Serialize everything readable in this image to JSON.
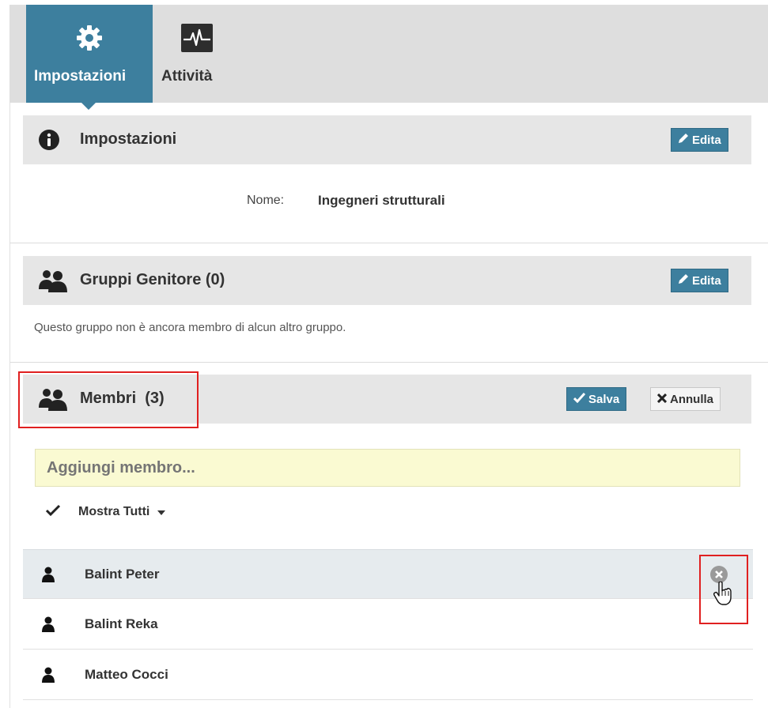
{
  "tabs": [
    {
      "label": "Impostazioni",
      "icon": "gear-icon",
      "active": true
    },
    {
      "label": "Attività",
      "icon": "activity-icon",
      "active": false
    }
  ],
  "settings": {
    "title": "Impostazioni",
    "icon": "info-icon",
    "edit_label": "Edita",
    "name_label": "Nome:",
    "name_value": "Ingegneri strutturali"
  },
  "parents": {
    "title": "Gruppi Genitore (0)",
    "icon": "users-icon",
    "edit_label": "Edita",
    "empty_text": "Questo gruppo non è ancora membro di alcun altro gruppo."
  },
  "members": {
    "title": "Membri",
    "count": "(3)",
    "icon": "users-icon",
    "save_label": "Salva",
    "cancel_label": "Annulla",
    "add_placeholder": "Aggiungi membro...",
    "filter_label": "Mostra Tutti",
    "list": [
      {
        "name": "Balint Peter"
      },
      {
        "name": "Balint Reka"
      },
      {
        "name": "Matteo Cocci"
      }
    ]
  },
  "colors": {
    "accent": "#3d7f9e",
    "highlight": "#e02020",
    "add_field_bg": "#fafad2"
  }
}
